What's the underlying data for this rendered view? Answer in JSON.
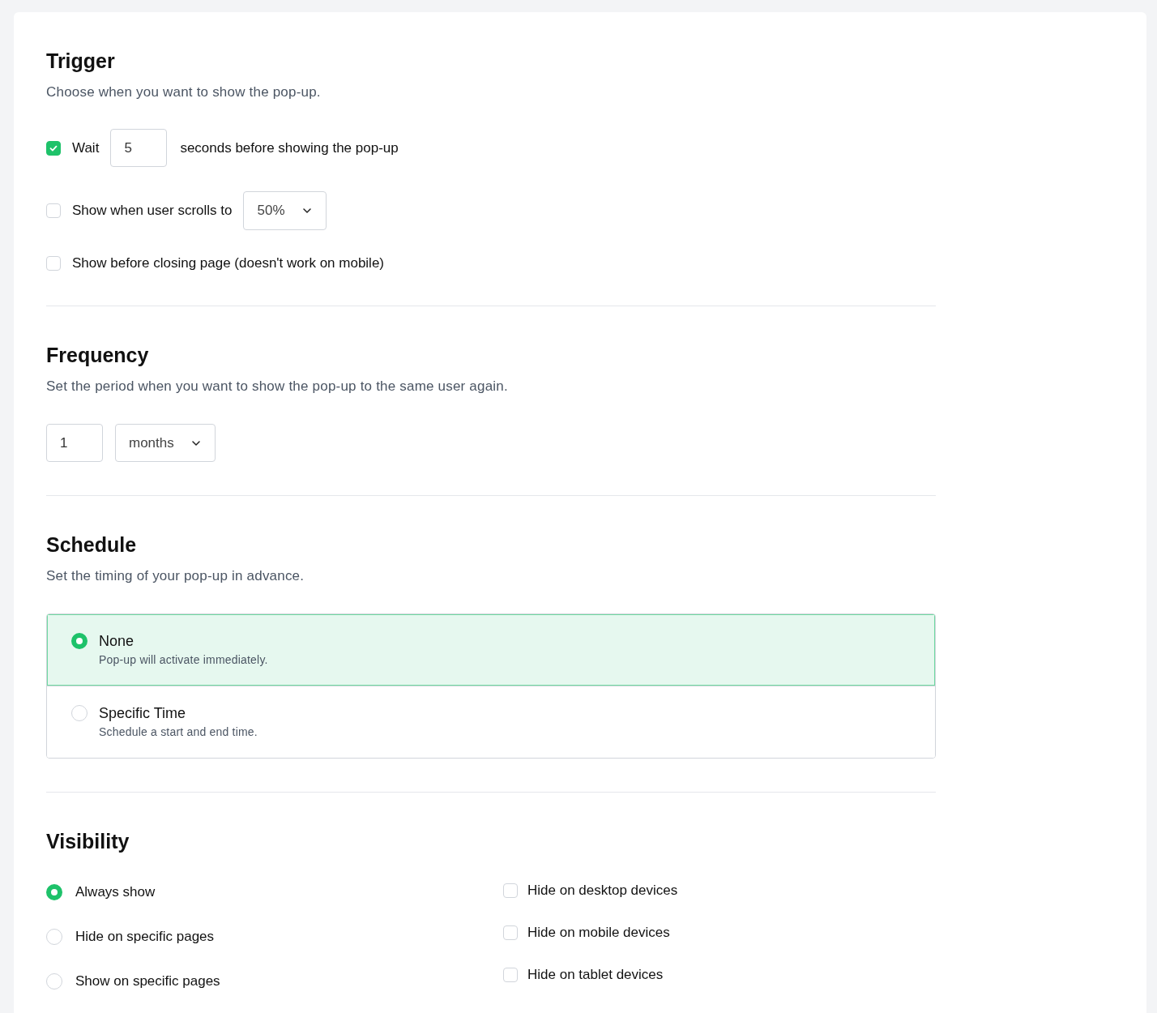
{
  "trigger": {
    "title": "Trigger",
    "description": "Choose when you want to show the pop-up.",
    "options": [
      {
        "kind": "wait",
        "checked": true,
        "label": "Wait",
        "value": "5",
        "suffix": "seconds before showing the pop-up"
      },
      {
        "kind": "scroll",
        "checked": false,
        "label": "Show when user scrolls to",
        "value": "50%"
      },
      {
        "kind": "plain",
        "checked": false,
        "label": "Show before closing page (doesn't work on mobile)"
      }
    ]
  },
  "frequency": {
    "title": "Frequency",
    "description": "Set the period when you want to show the pop-up to the same user again.",
    "amount": "1",
    "unit": "months"
  },
  "schedule": {
    "title": "Schedule",
    "description": "Set the timing of your pop-up in advance.",
    "options": [
      {
        "label": "None",
        "description": "Pop-up will activate immediately.",
        "selected": true
      },
      {
        "label": "Specific Time",
        "description": "Schedule a start and end time.",
        "selected": false
      }
    ]
  },
  "visibility": {
    "title": "Visibility",
    "pages": [
      {
        "label": "Always show",
        "selected": true
      },
      {
        "label": "Hide on specific pages",
        "selected": false
      },
      {
        "label": "Show on specific pages",
        "selected": false
      }
    ],
    "devices": [
      {
        "label": "Hide on desktop devices",
        "checked": false
      },
      {
        "label": "Hide on mobile devices",
        "checked": false
      },
      {
        "label": "Hide on tablet devices",
        "checked": false
      }
    ]
  }
}
